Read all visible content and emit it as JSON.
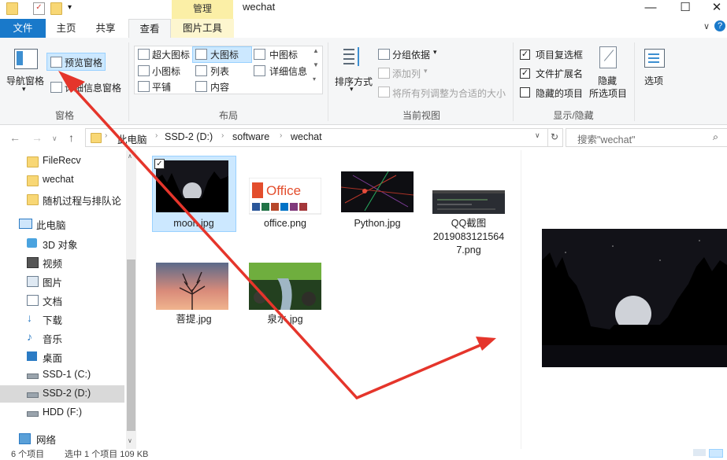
{
  "window": {
    "title": "wechat",
    "context_tab": "管理",
    "minimize": "—",
    "maximize": "☐",
    "close": "✕"
  },
  "tabs": {
    "file": "文件",
    "home": "主页",
    "share": "共享",
    "view": "查看",
    "picture_tools": "图片工具"
  },
  "ribbon": {
    "panes": {
      "nav_pane": "导航窗格",
      "preview": "预览窗格",
      "details": "详细信息窗格",
      "group": "窗格"
    },
    "layout": {
      "items": [
        "超大图标",
        "大图标",
        "中图标",
        "小图标",
        "列表",
        "详细信息",
        "平铺",
        "内容"
      ],
      "group": "布局"
    },
    "current_view": {
      "sort": "排序方式",
      "group_by": "分组依据",
      "add_column": "添加列",
      "fit_columns": "将所有列调整为合适的大小",
      "group": "当前视图"
    },
    "show_hide": {
      "item_checkbox": "项目复选框",
      "file_ext": "文件扩展名",
      "hidden_items": "隐藏的项目",
      "hide_selected": "隐藏",
      "hide_selected2": "所选项目",
      "options": "选项",
      "group": "显示/隐藏"
    }
  },
  "address": {
    "crumbs": [
      "此电脑",
      "SSD-2 (D:)",
      "software",
      "wechat"
    ],
    "search_placeholder": "搜索\"wechat\""
  },
  "navpane": {
    "items": [
      "FileRecv",
      "wechat",
      "随机过程与排队论",
      "此电脑",
      "3D 对象",
      "视频",
      "图片",
      "文档",
      "下载",
      "音乐",
      "桌面",
      "SSD-1 (C:)",
      "SSD-2 (D:)",
      "HDD (F:)",
      "网络"
    ]
  },
  "files": {
    "moon": "moon.jpg",
    "office": "office.png",
    "python": "Python.jpg",
    "qq1": "QQ截图",
    "qq2": "2019083121564",
    "qq3": "7.png",
    "puti": "菩提.jpg",
    "quanshui": "泉水.jpg",
    "office_logo": "Office"
  },
  "status": {
    "count": "6 个项目",
    "selected": "选中 1 个项目  109 KB"
  },
  "colors": {
    "accent": "#1979ca",
    "annotation": "#e5352b",
    "select": "#cce8ff"
  }
}
